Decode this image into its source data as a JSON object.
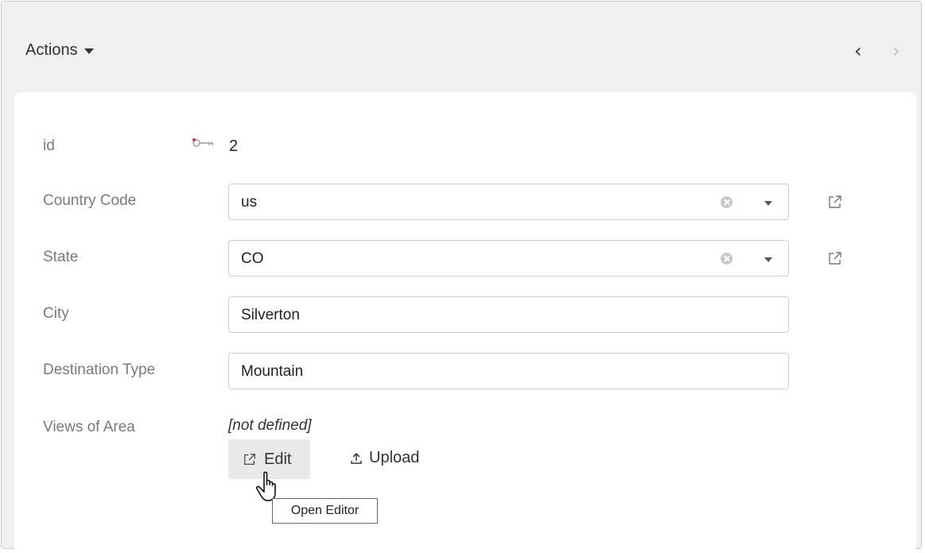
{
  "header": {
    "actions_label": "Actions",
    "prev_icon": "chevron-left-icon",
    "next_icon": "chevron-right-icon"
  },
  "record": {
    "id": {
      "label": "id",
      "value": "2",
      "icon": "key-icon"
    },
    "country_code": {
      "label": "Country Code",
      "value": "us"
    },
    "state": {
      "label": "State",
      "value": "CO"
    },
    "city": {
      "label": "City",
      "value": "Silverton"
    },
    "destination_type": {
      "label": "Destination Type",
      "value": "Mountain"
    },
    "views_of_area": {
      "label": "Views of Area",
      "value": "[not defined]",
      "edit_label": "Edit",
      "upload_label": "Upload"
    }
  },
  "tooltip": {
    "text": "Open Editor"
  },
  "colors": {
    "outer_bg": "#f0f0f0",
    "card_bg": "#ffffff",
    "label": "#7a7a7a",
    "border": "#cfcfcf",
    "button_bg": "#e9e9e9",
    "key_accent": "#d9333f"
  }
}
